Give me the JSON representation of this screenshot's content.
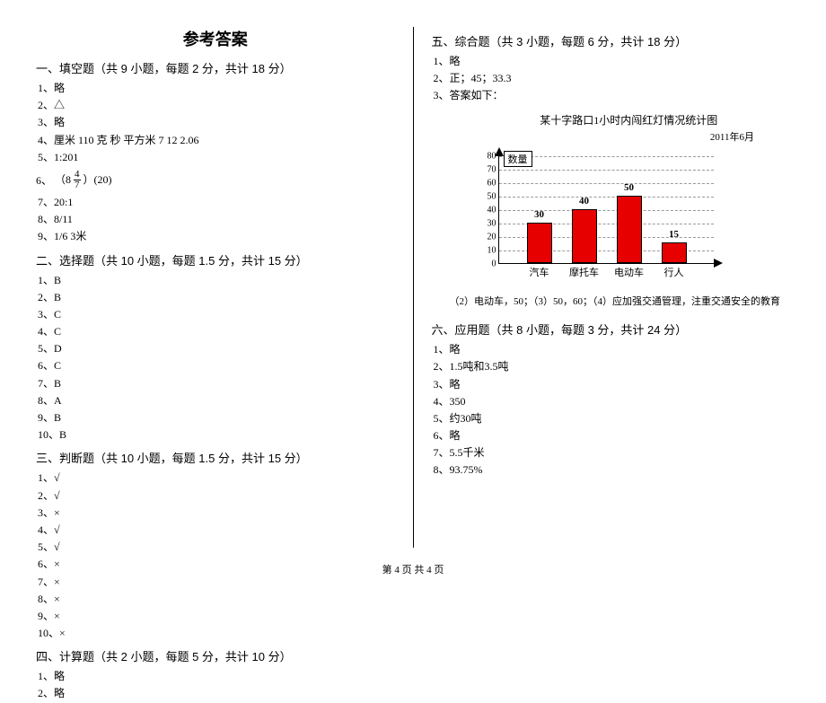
{
  "main_title": "参考答案",
  "page_footer": "第 4 页  共 4 页",
  "sections": {
    "s1": {
      "header": "一、填空题（共 9 小题，每题 2 分，共计 18 分）"
    },
    "s2": {
      "header": "二、选择题（共 10 小题，每题 1.5 分，共计 15 分）"
    },
    "s3": {
      "header": "三、判断题（共 10 小题，每题 1.5 分，共计 15 分）"
    },
    "s4": {
      "header": "四、计算题（共 2 小题，每题 5 分，共计 10 分）"
    },
    "s5": {
      "header": "五、综合题（共 3 小题，每题 6 分，共计 18 分）"
    },
    "s6": {
      "header": "六、应用题（共 8 小题，每题 3 分，共计 24 分）"
    }
  },
  "fill": {
    "a1": "1、略",
    "a2": "2、△",
    "a3": "3、略",
    "a4": "4、厘米    110    克    秒    平方米    7    12    2.06",
    "a5": "5、1:201",
    "a6_prefix": "6、",
    "a6_left": "（8",
    "a6_frac_num": "4",
    "a6_frac_den": "7",
    "a6_right": "）(20)",
    "a7": "7、20:1",
    "a8": "8、8/11",
    "a9": "9、1/6  3米"
  },
  "choice": {
    "a1": "1、B",
    "a2": "2、B",
    "a3": "3、C",
    "a4": "4、C",
    "a5": "5、D",
    "a6": "6、C",
    "a7": "7、B",
    "a8": "8、A",
    "a9": "9、B",
    "a10": "10、B"
  },
  "judge": {
    "a1": "1、√",
    "a2": "2、√",
    "a3": "3、×",
    "a4": "4、√",
    "a5": "5、√",
    "a6": "6、×",
    "a7": "7、×",
    "a8": "8、×",
    "a9": "9、×",
    "a10": "10、×"
  },
  "calc": {
    "a1": "1、略",
    "a2": "2、略"
  },
  "comp": {
    "a1": "1、略",
    "a2": "2、正；45；33.3",
    "a3": "3、答案如下：",
    "note": "（2）电动车，50；（3）50，60；（4）应加强交通管理，注重交通安全的教育"
  },
  "app": {
    "a1": "1、略",
    "a2": "2、1.5吨和3.5吨",
    "a3": "3、略",
    "a4": "4、350",
    "a5": "5、约30吨",
    "a6": "6、略",
    "a7": "7、5.5千米",
    "a8": "8、93.75%"
  },
  "chart_data": {
    "type": "bar",
    "title": "某十字路口1小时内闯红灯情况统计图",
    "subtitle": "2011年6月",
    "ylabel": "数量",
    "categories": [
      "汽车",
      "摩托车",
      "电动车",
      "行人"
    ],
    "values": [
      30,
      40,
      50,
      15
    ],
    "ylim": [
      0,
      80
    ],
    "yticks": [
      0,
      10,
      20,
      30,
      40,
      50,
      60,
      70,
      80
    ]
  }
}
